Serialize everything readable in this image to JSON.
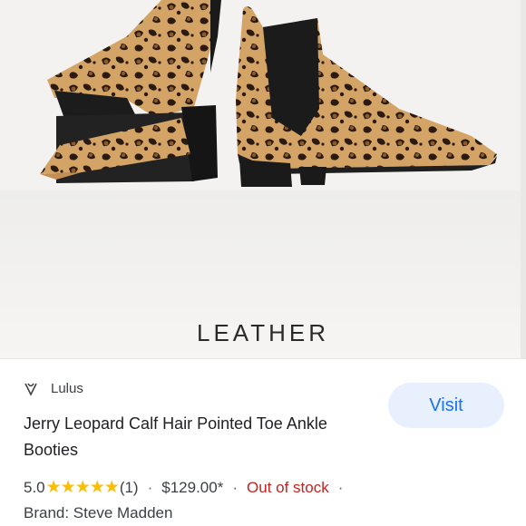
{
  "image": {
    "caption": "LEATHER",
    "alt_subject": "leopard print pointed toe ankle booties"
  },
  "result": {
    "source_icon": "lulus-heart-icon",
    "source_name": "Lulus",
    "title": "Jerry Leopard Calf Hair Pointed Toe Ankle Booties",
    "visit_label": "Visit",
    "rating": "5.0",
    "stars": "★★★★★",
    "review_count": "(1)",
    "separator": "·",
    "price": "$129.00*",
    "stock_status": "Out of stock",
    "brand": "Brand: Steve Madden"
  },
  "colors": {
    "accent": "#1a73e8",
    "visit_bg": "#e8f0fe",
    "stars": "#fbbc04",
    "out_of_stock": "#c5221f",
    "leopard_base": "#d6a86a",
    "leopard_spot": "#2b1a10"
  }
}
